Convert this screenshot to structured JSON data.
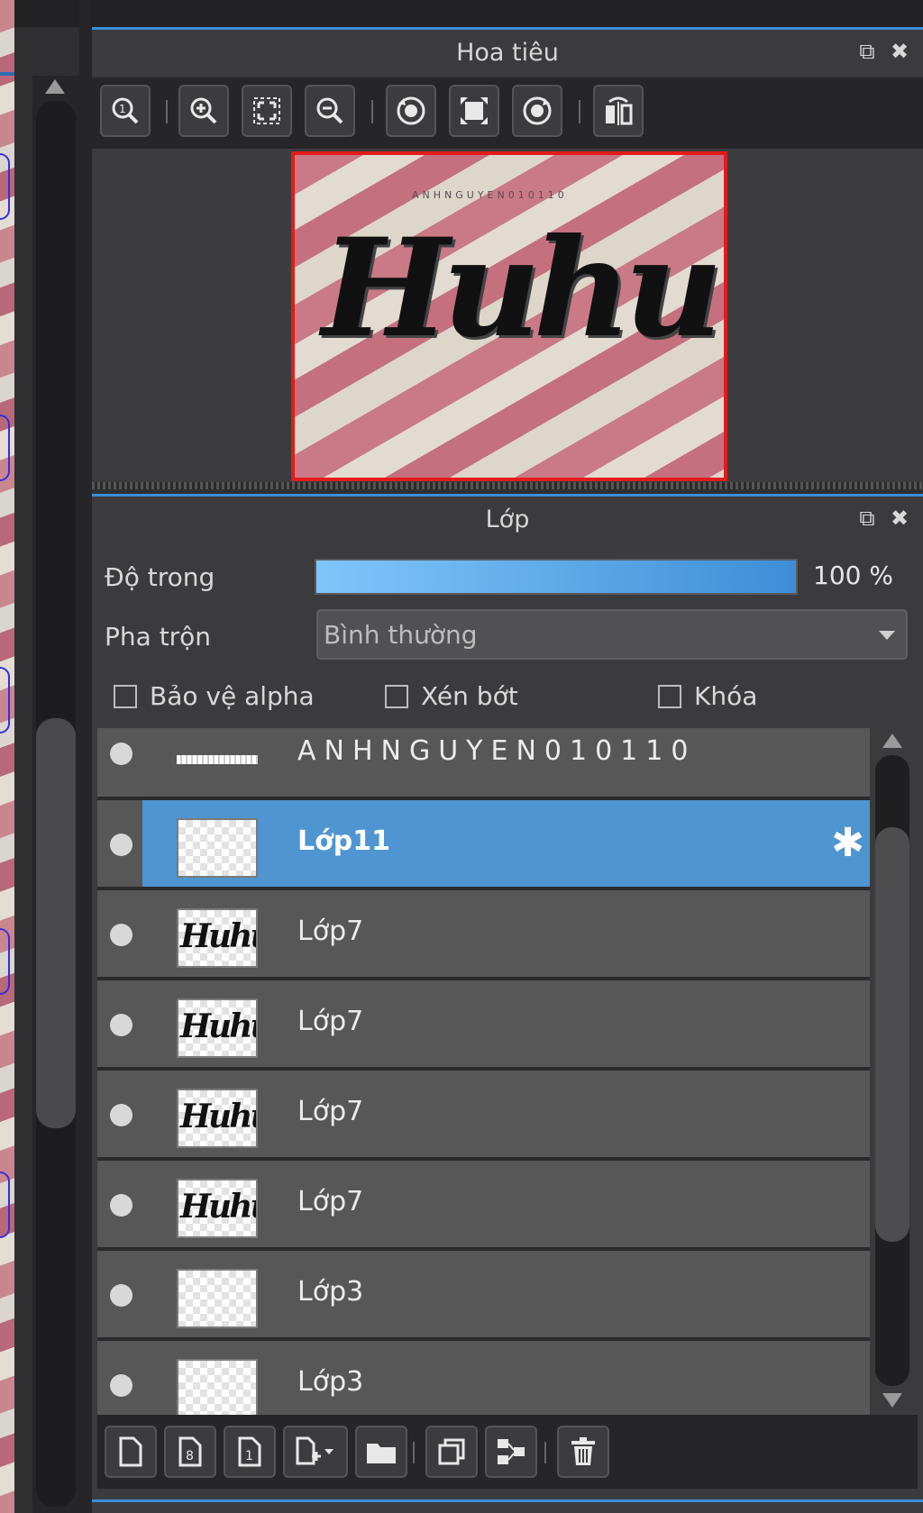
{
  "navigator": {
    "title": "Hoa tiêu",
    "toolbar_icons": [
      "zoom-actual-icon",
      "zoom-in-icon",
      "fit-screen-icon",
      "zoom-out-icon",
      "rotate-left-icon",
      "fit-canvas-icon",
      "rotate-right-icon",
      "flip-horizontal-icon"
    ],
    "preview": {
      "watermark_text": "ANHNGUYEN010110",
      "script_text": "Huhu"
    }
  },
  "layers_panel": {
    "title": "Lớp",
    "opacity": {
      "label": "Độ trong",
      "value": "100 %",
      "level": 1.0
    },
    "blend": {
      "label": "Pha trộn",
      "value": "Bình thường"
    },
    "checkboxes": [
      {
        "label": "Bảo vệ alpha",
        "checked": false
      },
      {
        "label": "Xén bớt",
        "checked": false
      },
      {
        "label": "Khóa",
        "checked": false
      }
    ],
    "layers": [
      {
        "name": "ANHNGUYEN010110",
        "kind": "text",
        "selected": false
      },
      {
        "name": "Lớp11",
        "kind": "empty",
        "selected": true
      },
      {
        "name": "Lớp7",
        "kind": "script",
        "selected": false
      },
      {
        "name": "Lớp7",
        "kind": "script",
        "selected": false
      },
      {
        "name": "Lớp7",
        "kind": "script",
        "selected": false
      },
      {
        "name": "Lớp7",
        "kind": "script",
        "selected": false
      },
      {
        "name": "Lớp3",
        "kind": "empty",
        "selected": false
      },
      {
        "name": "Lớp3",
        "kind": "empty",
        "selected": false
      }
    ],
    "thumb_script_text": "Huhu",
    "bottom_toolbar_icons": [
      "new-layer-icon",
      "new-8bit-layer-icon",
      "new-1bit-layer-icon",
      "add-layer-menu-icon",
      "new-folder-icon",
      "duplicate-layer-icon",
      "merge-layer-icon",
      "delete-layer-icon"
    ]
  },
  "colors": {
    "accent": "#3b8fd8",
    "selected_row": "#4f95d2",
    "frame_red": "#e21b1b"
  }
}
